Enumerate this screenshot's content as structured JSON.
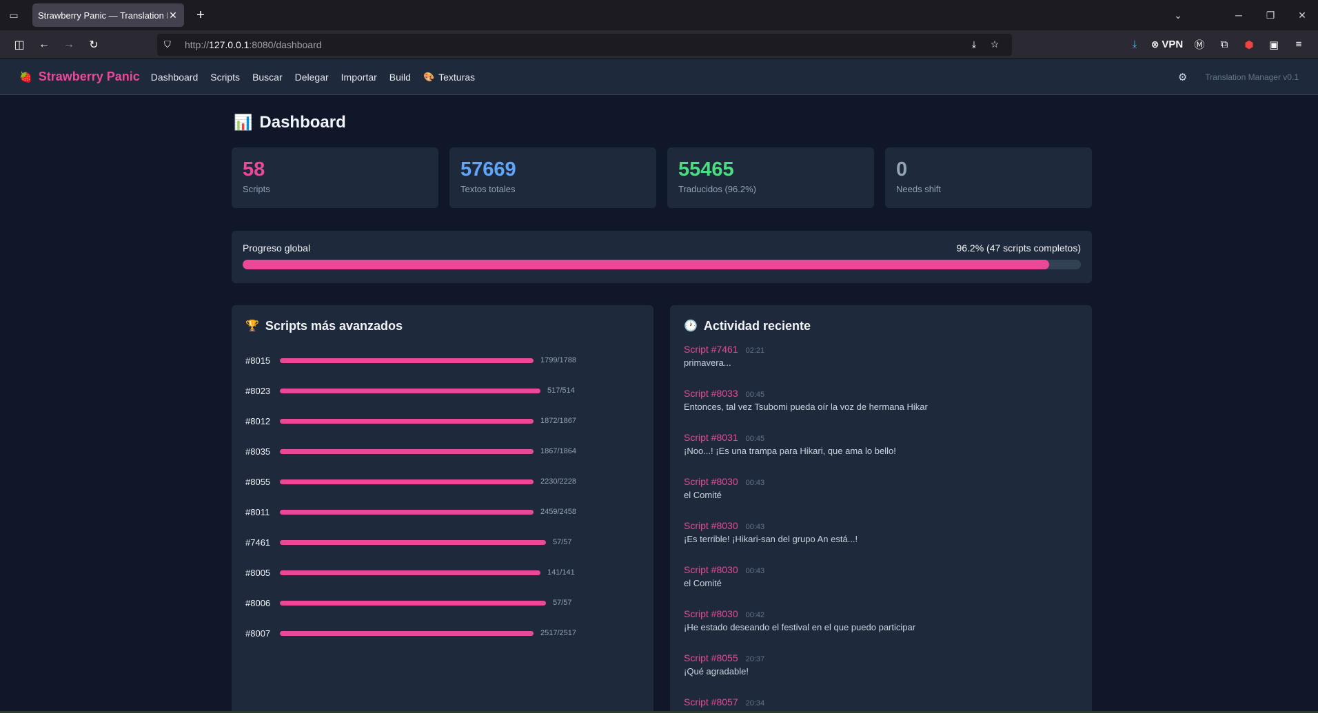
{
  "browser": {
    "tab_title": "Strawberry Panic — Translation Man",
    "url_prefix": "http://",
    "url_host": "127.0.0.1",
    "url_rest": ":8080/dashboard",
    "vpn_label": "VPN"
  },
  "app": {
    "brand": "Strawberry Panic",
    "menu": [
      {
        "label": "Dashboard"
      },
      {
        "label": "Scripts"
      },
      {
        "label": "Buscar"
      },
      {
        "label": "Delegar"
      },
      {
        "label": "Importar"
      },
      {
        "label": "Build"
      },
      {
        "label": "Texturas",
        "icon": "palette-icon"
      }
    ],
    "version": "Translation Manager v0.1"
  },
  "page": {
    "title": "Dashboard",
    "title_icon": "bar-chart-icon"
  },
  "stats": [
    {
      "value": "58",
      "label": "Scripts",
      "color": "#ec4899"
    },
    {
      "value": "57669",
      "label": "Textos totales",
      "color": "#60a5fa"
    },
    {
      "value": "55465",
      "label": "Traducidos (96.2%)",
      "color": "#4ade80"
    },
    {
      "value": "0",
      "label": "Needs shift",
      "color": "#94a3b8"
    }
  ],
  "progress": {
    "label": "Progreso global",
    "summary": "96.2% (47 scripts completos)",
    "percent": 96.2
  },
  "top_scripts": {
    "title": "Scripts más avanzados",
    "icon": "trophy-icon",
    "items": [
      {
        "id": "#8015",
        "done": 1799,
        "total": 1788,
        "count": "1799/1788"
      },
      {
        "id": "#8023",
        "done": 517,
        "total": 514,
        "count": "517/514"
      },
      {
        "id": "#8012",
        "done": 1872,
        "total": 1867,
        "count": "1872/1867"
      },
      {
        "id": "#8035",
        "done": 1867,
        "total": 1864,
        "count": "1867/1864"
      },
      {
        "id": "#8055",
        "done": 2230,
        "total": 2228,
        "count": "2230/2228"
      },
      {
        "id": "#8011",
        "done": 2459,
        "total": 2458,
        "count": "2459/2458"
      },
      {
        "id": "#7461",
        "done": 57,
        "total": 57,
        "count": "57/57"
      },
      {
        "id": "#8005",
        "done": 141,
        "total": 141,
        "count": "141/141"
      },
      {
        "id": "#8006",
        "done": 57,
        "total": 57,
        "count": "57/57"
      },
      {
        "id": "#8007",
        "done": 2517,
        "total": 2517,
        "count": "2517/2517"
      }
    ]
  },
  "activity": {
    "title": "Actividad reciente",
    "icon": "clock-icon",
    "items": [
      {
        "script": "Script #7461",
        "time": "02:21",
        "text": "primavera..."
      },
      {
        "script": "Script #8033",
        "time": "00:45",
        "text": "Entonces, tal vez Tsubomi pueda oír la voz de hermana Hikar"
      },
      {
        "script": "Script #8031",
        "time": "00:45",
        "text": "¡Noo...! ¡Es una trampa para Hikari, que ama lo bello!"
      },
      {
        "script": "Script #8030",
        "time": "00:43",
        "text": "el Comité"
      },
      {
        "script": "Script #8030",
        "time": "00:43",
        "text": "¡Es terrible! ¡Hikari-san del grupo An está...!"
      },
      {
        "script": "Script #8030",
        "time": "00:43",
        "text": "el Comité"
      },
      {
        "script": "Script #8030",
        "time": "00:42",
        "text": "¡He estado deseando el festival en el que puedo participar"
      },
      {
        "script": "Script #8055",
        "time": "20:37",
        "text": "¡Qué agradable!"
      },
      {
        "script": "Script #8057",
        "time": "20:34",
        "text": ""
      }
    ]
  }
}
